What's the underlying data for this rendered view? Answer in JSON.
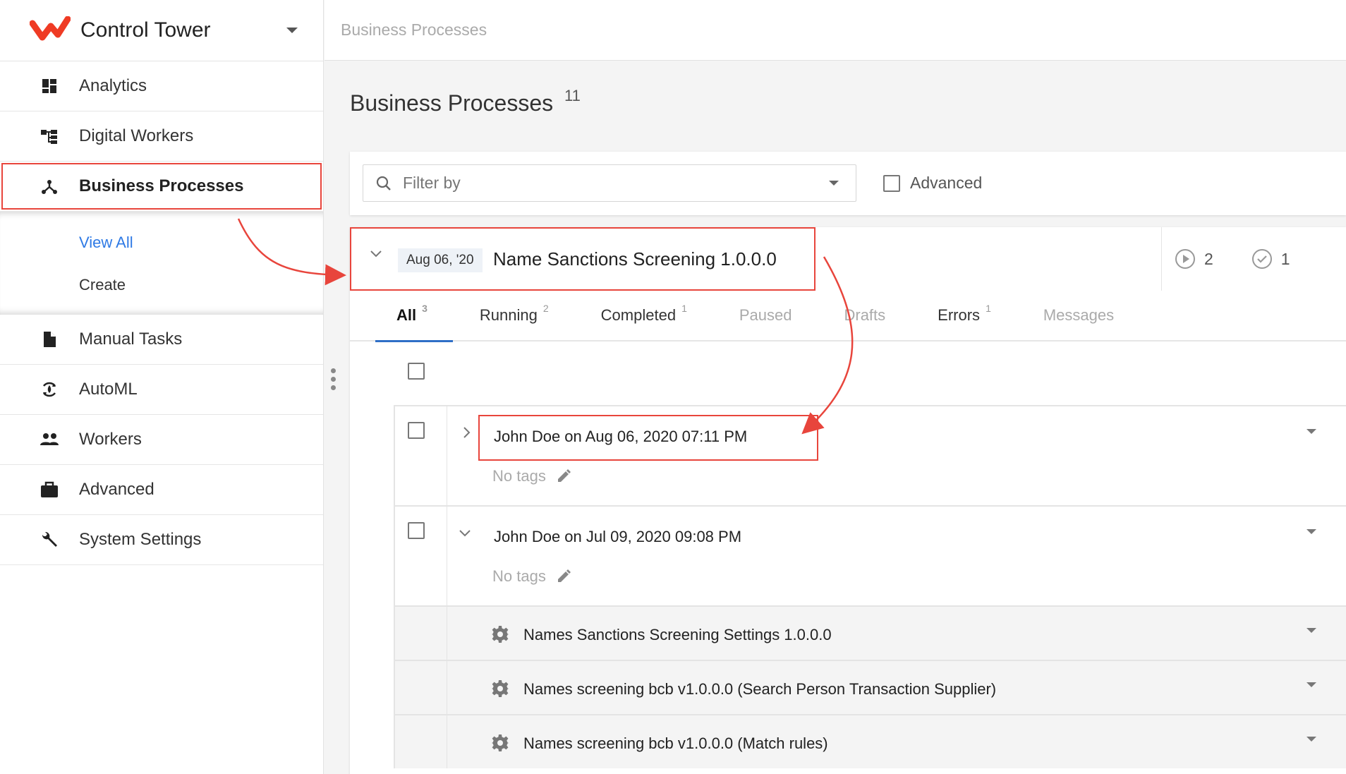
{
  "app": {
    "title": "Control Tower"
  },
  "sidebar": {
    "items": [
      {
        "label": "Analytics"
      },
      {
        "label": "Digital Workers"
      },
      {
        "label": "Business Processes"
      },
      {
        "label": "Manual Tasks"
      },
      {
        "label": "AutoML"
      },
      {
        "label": "Workers"
      },
      {
        "label": "Advanced"
      },
      {
        "label": "System Settings"
      }
    ],
    "subitems": [
      {
        "label": "View All"
      },
      {
        "label": "Create"
      }
    ]
  },
  "breadcrumb": "Business Processes",
  "page": {
    "title": "Business Processes",
    "count": "11"
  },
  "filter": {
    "placeholder": "Filter by",
    "advanced_label": "Advanced"
  },
  "process": {
    "date": "Aug 06, '20",
    "name": "Name Sanctions Screening 1.0.0.0",
    "running_count": "2",
    "completed_count": "1"
  },
  "tabs": [
    {
      "label": "All",
      "count": "3"
    },
    {
      "label": "Running",
      "count": "2"
    },
    {
      "label": "Completed",
      "count": "1"
    },
    {
      "label": "Paused",
      "count": ""
    },
    {
      "label": "Drafts",
      "count": ""
    },
    {
      "label": "Errors",
      "count": "1"
    },
    {
      "label": "Messages",
      "count": ""
    }
  ],
  "runs": [
    {
      "who": "John Doe on  Aug 06, 2020 07:11 PM",
      "tags": "No tags"
    },
    {
      "who": "John Doe on  Jul 09, 2020 09:08 PM",
      "tags": "No tags"
    }
  ],
  "steps": [
    {
      "label": "Names Sanctions Screening Settings 1.0.0.0"
    },
    {
      "label": "Names screening bcb v1.0.0.0 (Search Person Transaction Supplier)"
    },
    {
      "label": "Names screening bcb v1.0.0.0 (Match rules)"
    }
  ],
  "colors": {
    "accent": "#e8453c",
    "link": "#2f7ae5",
    "tab_indicator": "#2f6fc7"
  }
}
